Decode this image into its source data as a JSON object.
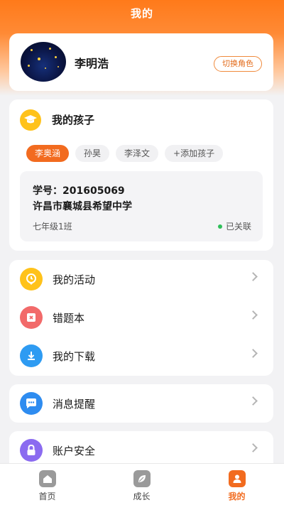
{
  "header": {
    "title": "我的"
  },
  "profile": {
    "name": "李明浩",
    "switch_role": "切换角色"
  },
  "children": {
    "title": "我的孩子",
    "tabs": [
      "李奥涵",
      "孙昊",
      "李泽文",
      "+添加孩子"
    ],
    "selected": "李奥涵",
    "info": {
      "student_id_label": "学号：",
      "student_id": "201605069",
      "school": "许昌市襄城县希望中学",
      "grade": "七年级1班",
      "status": "已关联"
    }
  },
  "menu": {
    "activities": "我的活动",
    "mistakes": "错题本",
    "downloads": "我的下载",
    "notifications": "消息提醒",
    "security": "账户安全"
  },
  "tabbar": {
    "home": "首页",
    "growth": "成长",
    "mine": "我的",
    "active": "我的"
  },
  "colors": {
    "accent": "#f26b1f",
    "linked": "#2fbf5a"
  }
}
